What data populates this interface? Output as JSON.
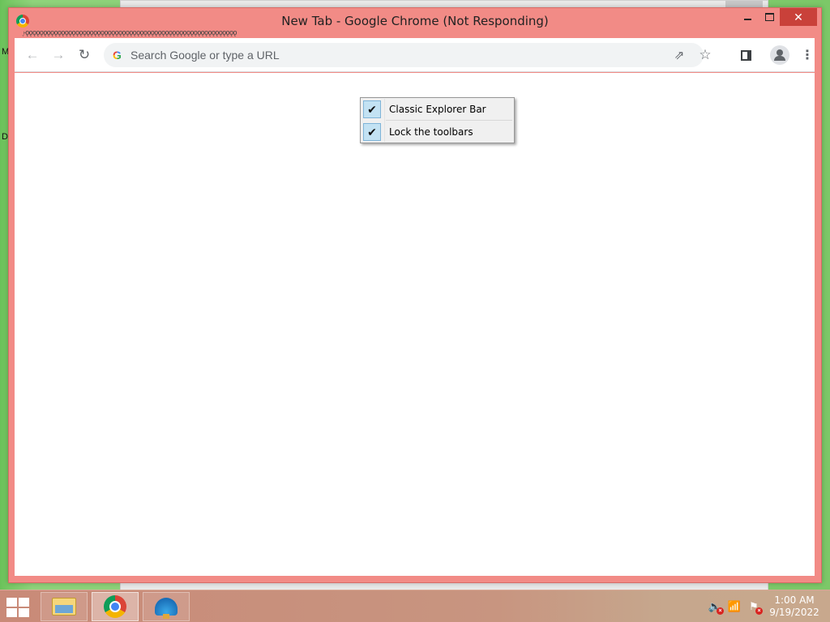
{
  "desktop": {
    "left_letters": [
      "M",
      "D"
    ]
  },
  "window": {
    "title": "New Tab - Google Chrome (Not Responding)",
    "close_glyph": "✕",
    "tabstrip_garble": "˯˫ǫǫǫǫǫǫǫǫǫǫǫǫǫǫǫǫǫǫǫǫǫǫǫǫǫǫǫǫǫǫǫǫǫǫǫǫǫǫǫǫǫǫǫǫǫǫǫǫǫǫǫǫǫǫǫǫǫǫǫ"
  },
  "toolbar": {
    "back_glyph": "←",
    "forward_glyph": "→",
    "reload_glyph": "↻",
    "omnibox_placeholder": "Search Google or type a URL",
    "google_letter": "G",
    "share_glyph": "⇗",
    "star_glyph": "☆",
    "menu_glyph": "⋮"
  },
  "context_menu": {
    "items": [
      {
        "label": "Classic Explorer Bar",
        "checked": true,
        "check_glyph": "✔"
      },
      {
        "label": "Lock the toolbars",
        "checked": true,
        "check_glyph": "✔"
      }
    ]
  },
  "taskbar": {
    "apps": [
      {
        "name": "File Explorer",
        "icon": "folder-icon",
        "active": false
      },
      {
        "name": "Google Chrome",
        "icon": "chrome-icon",
        "active": true
      },
      {
        "name": "Shell",
        "icon": "shell-icon",
        "active": false
      }
    ],
    "tray": {
      "volume_glyph": "🔈",
      "network_glyph": "📶",
      "flag_glyph": "⚑",
      "error_glyph": "×"
    },
    "clock": {
      "time": "1:00 AM",
      "date": "9/19/2022"
    }
  },
  "colors": {
    "window_frame": "#f28b86",
    "close_button": "#c9413a",
    "menu_check_bg": "#c3e2f3",
    "taskbar": "#c98a78"
  }
}
